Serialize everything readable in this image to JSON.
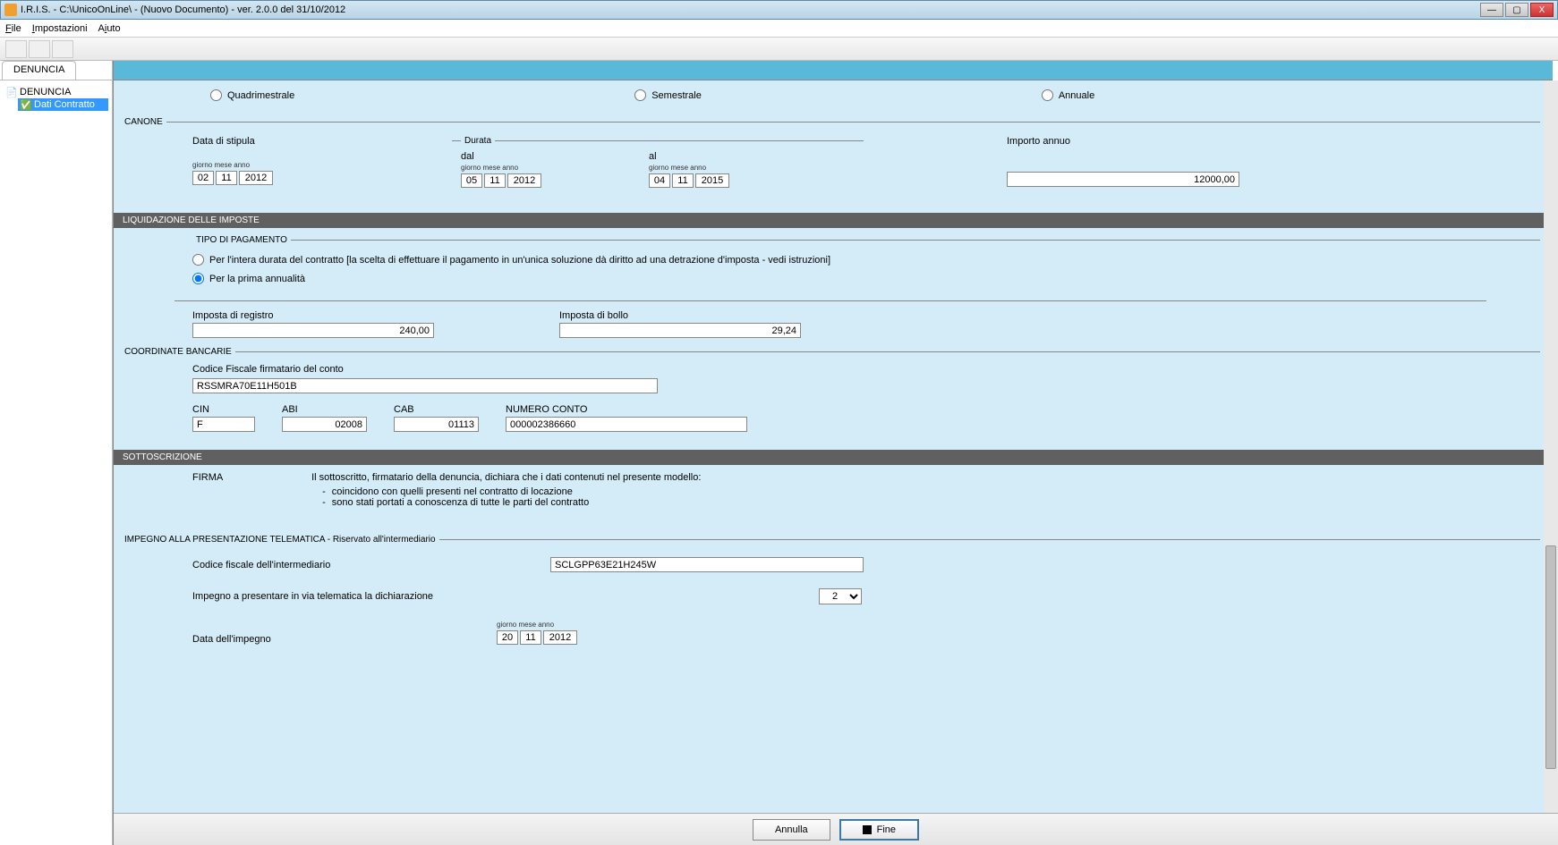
{
  "title": "I.R.I.S. - C:\\UnicoOnLine\\ - (Nuovo Documento)  -  ver. 2.0.0 del 31/10/2012",
  "menu": {
    "file": "File",
    "impostazioni": "Impostazioni",
    "aiuto": "Aiuto"
  },
  "tab": "DENUNCIA",
  "tree": {
    "root": "DENUNCIA",
    "child": "Dati Contratto"
  },
  "periodicita": {
    "quad": "Quadrimestrale",
    "sem": "Semestrale",
    "ann": "Annuale"
  },
  "canone": {
    "legend": "CANONE",
    "data_stipula_lbl": "Data di stipula",
    "gma": "giorno mese  anno",
    "stipula": {
      "g": "02",
      "m": "11",
      "a": "2012"
    },
    "durata_legend": "Durata",
    "dal_lbl": "dal",
    "al_lbl": "al",
    "dal": {
      "g": "05",
      "m": "11",
      "a": "2012"
    },
    "al": {
      "g": "04",
      "m": "11",
      "a": "2015"
    },
    "importo_lbl": "Importo annuo",
    "importo": "12000,00"
  },
  "liquidazione": {
    "bar": "LIQUIDAZIONE DELLE IMPOSTE",
    "tipo_legend": "TIPO DI PAGAMENTO",
    "opt1": "Per l'intera durata del contratto [la scelta di effettuare il pagamento in un'unica soluzione dà diritto ad una detrazione d'imposta - vedi istruzioni]",
    "opt2": "Per la prima annualità",
    "imposta_registro_lbl": "Imposta di registro",
    "imposta_registro": "240,00",
    "imposta_bollo_lbl": "Imposta di bollo",
    "imposta_bollo": "29,24"
  },
  "coord": {
    "legend": "COORDINATE BANCARIE",
    "cf_lbl": "Codice Fiscale firmatario del conto",
    "cf": "RSSMRA70E11H501B",
    "cin_lbl": "CIN",
    "cin": "F",
    "abi_lbl": "ABI",
    "abi": "02008",
    "cab_lbl": "CAB",
    "cab": "01113",
    "conto_lbl": "NUMERO CONTO",
    "conto": "000002386660"
  },
  "sottoscrizione": {
    "bar": "SOTTOSCRIZIONE",
    "firma_lbl": "FIRMA",
    "intro": "Il sottoscritto, firmatario della denuncia, dichiara che i dati contenuti nel presente modello:",
    "li1": "coincidono con quelli presenti nel contratto di locazione",
    "li2": "sono stati portati a conoscenza di tutte le parti del contratto"
  },
  "impegno": {
    "legend": "IMPEGNO ALLA PRESENTAZIONE TELEMATICA - Riservato all'intermediario",
    "cf_lbl": "Codice fiscale dell'intermediario",
    "cf": "SCLGPP63E21H245W",
    "pres_lbl": "Impegno a presentare in via telematica la dichiarazione",
    "pres_val": "2",
    "data_lbl": "Data dell'impegno",
    "gma": "giorno mese  anno",
    "data": {
      "g": "20",
      "m": "11",
      "a": "2012"
    }
  },
  "footer": {
    "annulla": "Annulla",
    "fine": "Fine"
  }
}
